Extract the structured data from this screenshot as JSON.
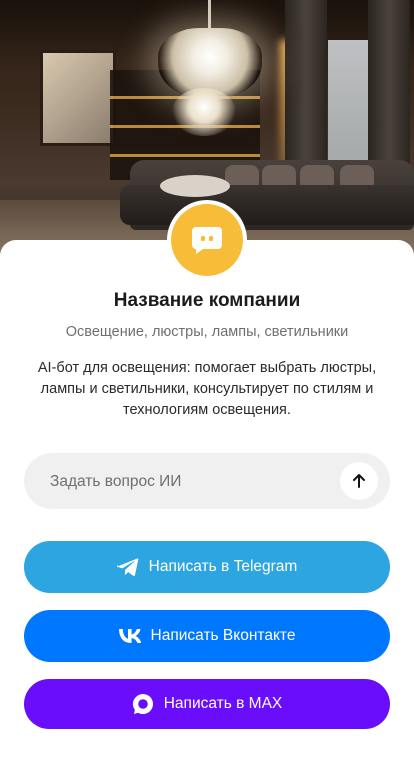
{
  "company": {
    "name": "Название компании",
    "subtitle": "Освещение, люстры, лампы, светильники",
    "description": "AI-бот для освещения: помогает выбрать люстры, лампы и светильники, консультирует по стилям и технологиям освещения."
  },
  "ask": {
    "placeholder": "Задать вопрос ИИ",
    "value": ""
  },
  "buttons": {
    "telegram": {
      "label": "Написать в Telegram",
      "icon": "telegram-icon",
      "color": "#2ca5e0"
    },
    "vk": {
      "label": "Написать Вконтакте",
      "icon": "vk-icon",
      "color": "#0077ff"
    },
    "max": {
      "label": "Написать в MAX",
      "icon": "max-icon",
      "color": "#6a0dfb"
    }
  },
  "colors": {
    "logo_bg": "#f7bd38",
    "ask_bg": "#f0f0f0"
  }
}
